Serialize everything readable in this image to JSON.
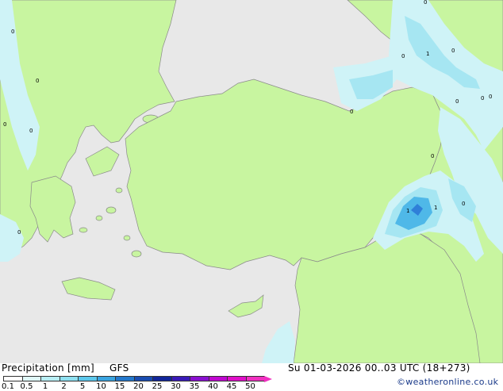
{
  "map": {
    "colors": {
      "sea": "#e8e8e8",
      "land": "#c8f5a0",
      "precip_light": "#cff3f7",
      "precip_mid": "#a6e6f2",
      "precip_heavy": "#4fb8e8",
      "precip_core": "#2f7fd8",
      "coast": "#8a8a8a",
      "border": "#777777"
    },
    "isoline_labels": [
      "0",
      "0",
      "0",
      "1",
      "0",
      "0",
      "0",
      "0",
      "0",
      "0",
      "0",
      "0",
      "0",
      "1",
      "1",
      "0",
      "0"
    ]
  },
  "footer": {
    "title": "Precipitation [mm]",
    "model": "GFS",
    "datetime": "Su 01-03-2026 00..03 UTC (18+273)",
    "credit": "©weatheronline.co.uk"
  },
  "legend": {
    "ticks": [
      "0.1",
      "0.5",
      "1",
      "2",
      "5",
      "10",
      "15",
      "20",
      "25",
      "30",
      "35",
      "40",
      "45",
      "50"
    ],
    "colors": [
      "#ffffff",
      "#e0f8f8",
      "#b8eef4",
      "#8ee0f0",
      "#5cc8ec",
      "#3aa4e0",
      "#2478cc",
      "#1a4cb0",
      "#12269a",
      "#3a1ab8",
      "#8a10d0",
      "#c008d0",
      "#e010c8",
      "#f030c0"
    ]
  }
}
